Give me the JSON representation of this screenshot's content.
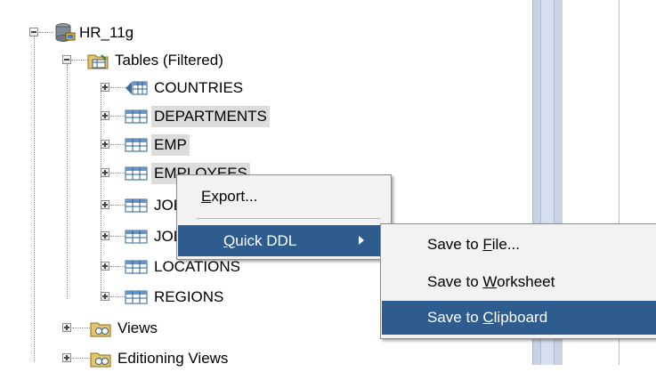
{
  "tree": {
    "connection": {
      "label": "HR_11g",
      "icon": "database-connection-icon"
    },
    "tables_folder": {
      "label": "Tables (Filtered)",
      "icon": "table-folder-icon"
    },
    "tables": [
      {
        "label": "COUNTRIES",
        "icon": "index-organized-table-icon"
      },
      {
        "label": "DEPARTMENTS",
        "icon": "table-icon"
      },
      {
        "label": "EMP",
        "icon": "table-icon"
      },
      {
        "label": "EMPLOYEES",
        "icon": "table-icon"
      },
      {
        "label": "JOBS",
        "icon": "table-icon"
      },
      {
        "label": "JOB_HISTORY",
        "icon": "table-icon"
      },
      {
        "label": "LOCATIONS",
        "icon": "table-icon"
      },
      {
        "label": "REGIONS",
        "icon": "table-icon"
      }
    ],
    "views": {
      "label": "Views",
      "icon": "view-folder-icon"
    },
    "editioning_views": {
      "label": "Editioning Views",
      "icon": "view-folder-icon"
    }
  },
  "context_menu": {
    "export": {
      "prefix": "",
      "mnemonic": "E",
      "suffix": "xport..."
    },
    "quick_ddl": {
      "prefix": "",
      "mnemonic": "Q",
      "suffix": "uick DDL"
    }
  },
  "submenu": {
    "save_file": {
      "prefix": "Save to ",
      "mnemonic": "F",
      "suffix": "ile..."
    },
    "save_worksheet": {
      "prefix": "Save to ",
      "mnemonic": "W",
      "suffix": "orksheet"
    },
    "save_clipboard": {
      "prefix": "Save to ",
      "mnemonic": "C",
      "suffix": "lipboard"
    }
  },
  "colors": {
    "menu_highlight": "#2e5c8f",
    "row_selection": "#dcdcdc",
    "scroll_track": "#c9d3e3"
  }
}
